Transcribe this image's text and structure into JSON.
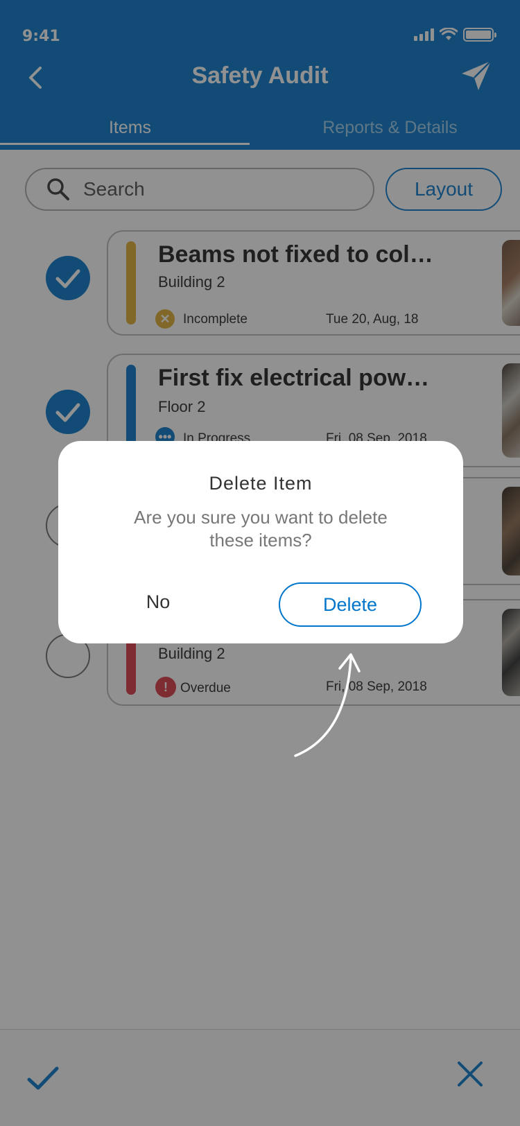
{
  "status_bar": {
    "time": "9:41"
  },
  "header": {
    "title": "Safety Audit",
    "back_icon": "chevron-left-icon",
    "send_icon": "paper-plane-icon"
  },
  "tabs": [
    {
      "label": "Items",
      "active": true
    },
    {
      "label": "Reports & Details",
      "active": false
    }
  ],
  "search": {
    "placeholder": "Search"
  },
  "layout_button": {
    "label": "Layout"
  },
  "items": [
    {
      "selected": true,
      "title": "Beams not fixed to col…",
      "location": "Building 2",
      "status": "Incomplete",
      "date": "Tue 20, Aug, 18",
      "stripe_color": "#e0ad2c"
    },
    {
      "selected": true,
      "title": "First fix electrical pow…",
      "location": "Floor 2",
      "status": "In Progress",
      "date": "Fri, 08 Sep, 2018",
      "stripe_color": "#0075c9"
    },
    {
      "selected": false,
      "title": "",
      "location": "",
      "status": "",
      "date": "",
      "stripe_color": "#cfcfcf"
    },
    {
      "selected": false,
      "title": "",
      "location": "Building 2",
      "status": "Overdue",
      "date": "Fri, 08 Sep, 2018",
      "stripe_color": "#d9333f"
    }
  ],
  "dialog": {
    "title": "Delete Item",
    "message": "Are you sure you want to delete these items?",
    "cancel_label": "No",
    "confirm_label": "Delete"
  },
  "toolbar": {
    "confirm_icon": "checkmark-icon",
    "cancel_icon": "close-icon"
  },
  "colors": {
    "brand": "#0075c9",
    "incomplete": "#e0ad2c",
    "overdue": "#d9333f"
  }
}
